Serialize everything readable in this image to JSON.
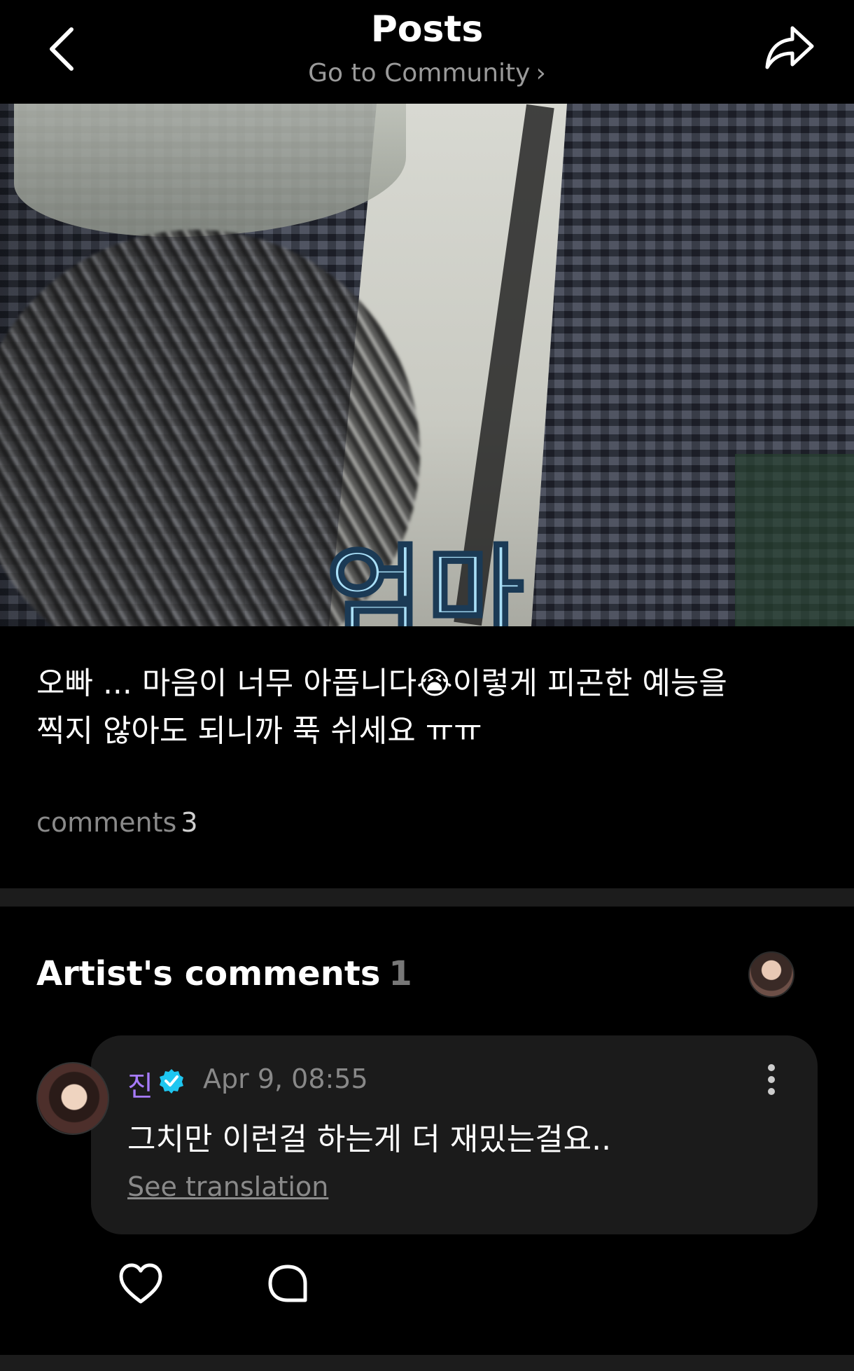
{
  "header": {
    "title": "Posts",
    "community_link": "Go to Community"
  },
  "post": {
    "image_overlay_text": "엄마",
    "text_line1": "오빠 ... 마음이 너무 아픕니다😭이렇게 피곤한 예능을",
    "text_line2": "찍지 않아도 되니까 푹 쉬세요 ㅠㅠ",
    "comments_label": "comments",
    "comments_count": "3"
  },
  "artist_comments": {
    "title": "Artist's comments",
    "count": "1",
    "comment": {
      "author": "진",
      "verified": true,
      "timestamp": "Apr 9, 08:55",
      "text": "그치만 이런걸 하는게 더 재밌는걸요..",
      "translate_label": "See translation"
    }
  },
  "colors": {
    "background": "#000000",
    "author_name": "#a77bff",
    "verified_badge": "#1ec6f0",
    "overlay_text": "#a9dff7",
    "muted_text": "#8a8a8a"
  },
  "icons": {
    "back": "chevron-left",
    "share": "share-arrow",
    "more": "vertical-ellipsis",
    "like": "heart-outline",
    "reply": "speech-bubble-outline"
  }
}
